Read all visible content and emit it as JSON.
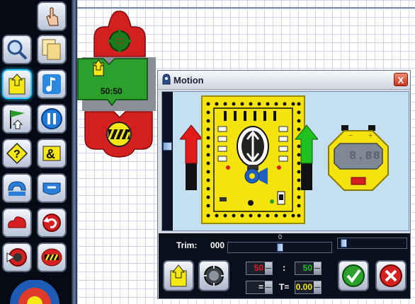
{
  "palette": {
    "items": [
      {
        "name": "hand-tool-icon",
        "selected": false
      },
      {
        "name": "zoom-icon",
        "selected": false
      },
      {
        "name": "copy-icon",
        "selected": false
      },
      {
        "name": "motion-command-icon",
        "selected": true
      },
      {
        "name": "sound-note-icon",
        "selected": false
      },
      {
        "name": "flag-start-icon",
        "selected": false
      },
      {
        "name": "pause-icon",
        "selected": false
      },
      {
        "name": "question-decision-icon",
        "selected": false
      },
      {
        "name": "ampersand-icon",
        "selected": false
      },
      {
        "name": "loop-icon",
        "selected": false
      },
      {
        "name": "loop-end-icon",
        "selected": false
      },
      {
        "name": "cloud-icon",
        "selected": false
      },
      {
        "name": "return-arrow-icon",
        "selected": false
      },
      {
        "name": "gear-arrow-icon",
        "selected": false
      },
      {
        "name": "end-block-icon",
        "selected": false
      }
    ]
  },
  "canvas": {
    "motion_block_value": "50:50"
  },
  "dialog": {
    "title": "Motion",
    "close_label": "X",
    "trim_label": "Trim:",
    "trim_value": "000",
    "trim_slider_tick": "0",
    "left_power": "50",
    "right_power": "50",
    "separator": ":",
    "compare_op": "=",
    "time_label": "T=",
    "time_value": "0.00",
    "timer_display": "8.88",
    "colors": {
      "accent_green": "#2ca02c",
      "accent_red": "#d42020",
      "robot_yellow": "#f5e30f"
    }
  }
}
